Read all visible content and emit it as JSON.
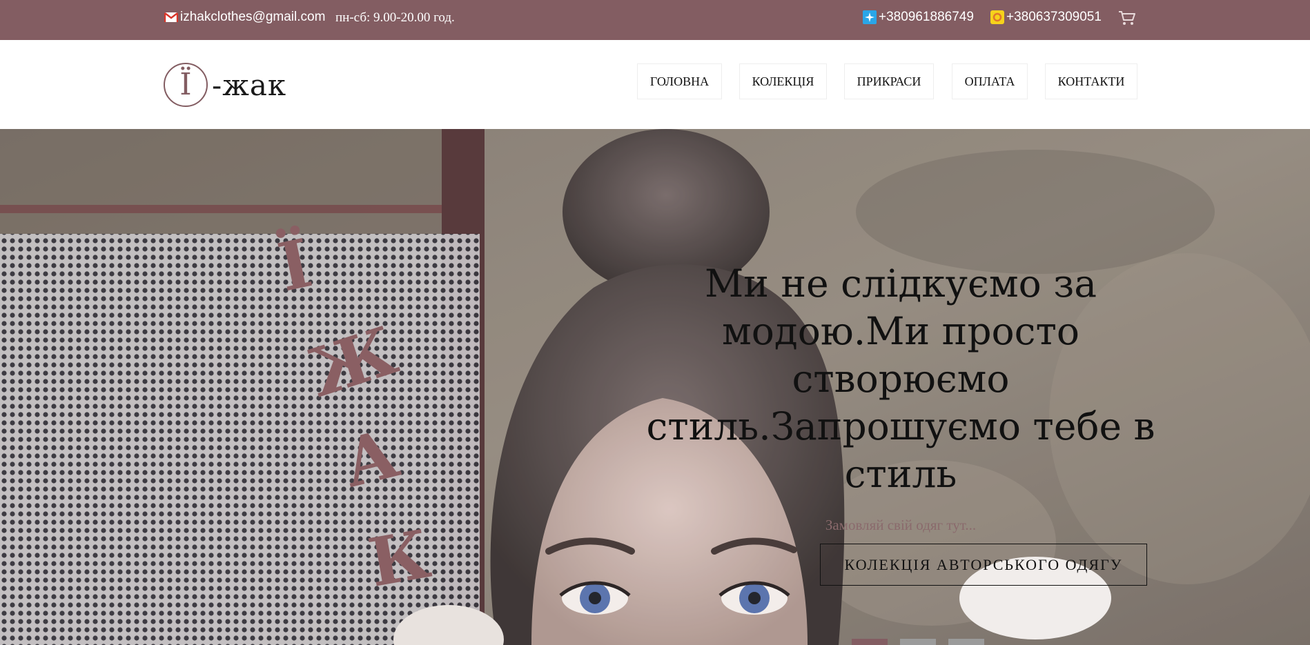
{
  "topbar": {
    "email": "izhakclothes@gmail.com",
    "hours": "пн-сб: 9.00-20.00 год.",
    "phone_1": "+380961886749",
    "phone_2": "+380637309051",
    "icons": [
      "mail-icon",
      "kyivstar-icon",
      "lifecell-icon",
      "cart-icon"
    ]
  },
  "logo": {
    "mark": "Ї",
    "text": "-жак"
  },
  "nav": {
    "items": [
      {
        "label": "ГОЛОВНА"
      },
      {
        "label": "КОЛЕКЦІЯ"
      },
      {
        "label": "ПРИКРАСИ"
      },
      {
        "label": "ОПЛАТА"
      },
      {
        "label": "КОНТАКТИ"
      }
    ]
  },
  "hero": {
    "vertical_letters": [
      "Ї",
      "Ж",
      "А",
      "К"
    ],
    "title": "Ми не слідкуємо за модою.Ми просто створюємо стиль.Запрошуємо тебе в стиль",
    "subtitle": "Замовляй свій одяг тут...",
    "button_label": "КОЛЕКЦІЯ АВТОРСЬКОГО ОДЯГУ",
    "slides_count": 3,
    "active_slide": 1
  },
  "colors": {
    "brand": "#835d62",
    "text": "#111111",
    "white": "#ffffff",
    "inactive_dot": "#9b9b9b"
  }
}
